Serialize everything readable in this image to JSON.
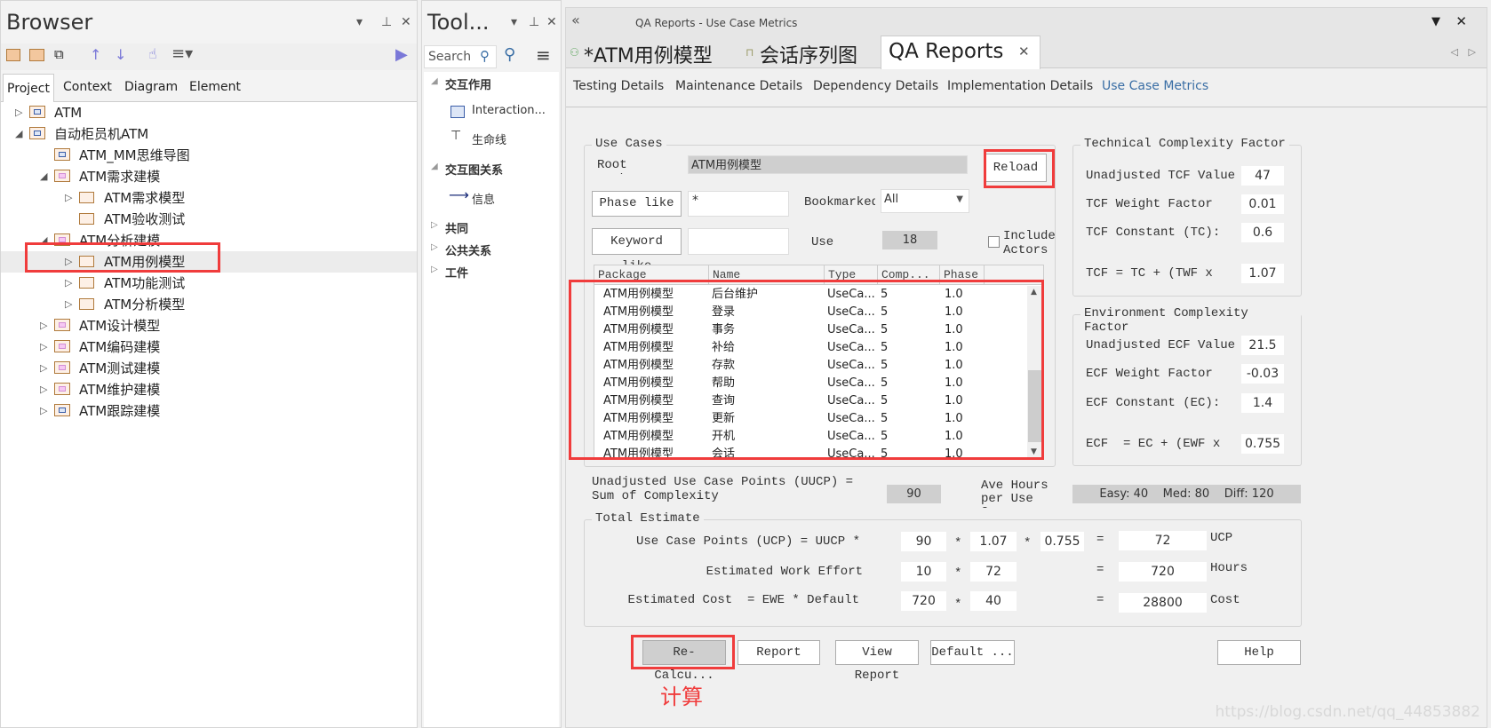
{
  "browser": {
    "title": "Browser",
    "tabs": [
      "Project",
      "Context",
      "Diagram",
      "Element"
    ],
    "tree": [
      {
        "label": "ATM",
        "level": 0,
        "expander": "collapsed",
        "icon": "package-icon"
      },
      {
        "label": "自动柜员机ATM",
        "level": 0,
        "expander": "expanded",
        "icon": "package-icon"
      },
      {
        "label": "ATM_MM思维导图",
        "level": 1,
        "expander": "none",
        "icon": "view-icon-blue"
      },
      {
        "label": "ATM需求建模",
        "level": 1,
        "expander": "expanded",
        "icon": "view-icon"
      },
      {
        "label": "ATM需求模型",
        "level": 2,
        "expander": "collapsed",
        "icon": "folder-icon"
      },
      {
        "label": "ATM验收测试",
        "level": 2,
        "expander": "none",
        "icon": "folder-icon"
      },
      {
        "label": "ATM分析建模",
        "level": 1,
        "expander": "expanded",
        "icon": "view-icon"
      },
      {
        "label": "ATM用例模型",
        "level": 2,
        "expander": "collapsed",
        "icon": "folder-icon",
        "selected": true
      },
      {
        "label": "ATM功能测试",
        "level": 2,
        "expander": "collapsed",
        "icon": "folder-icon"
      },
      {
        "label": "ATM分析模型",
        "level": 2,
        "expander": "collapsed",
        "icon": "folder-icon"
      },
      {
        "label": "ATM设计模型",
        "level": 1,
        "expander": "collapsed",
        "icon": "view-icon"
      },
      {
        "label": "ATM编码建模",
        "level": 1,
        "expander": "collapsed",
        "icon": "view-icon"
      },
      {
        "label": "ATM测试建模",
        "level": 1,
        "expander": "collapsed",
        "icon": "view-icon"
      },
      {
        "label": "ATM维护建模",
        "level": 1,
        "expander": "collapsed",
        "icon": "view-icon"
      },
      {
        "label": "ATM跟踪建模",
        "level": 1,
        "expander": "collapsed",
        "icon": "view-icon-blue"
      }
    ]
  },
  "toolbox": {
    "title": "Tool...",
    "search_placeholder": "Search",
    "sections": [
      {
        "label": "交互作用",
        "expanded": true,
        "items": [
          "Interaction...",
          "生命线"
        ]
      },
      {
        "label": "交互图关系",
        "expanded": true,
        "items": [
          "信息"
        ]
      },
      {
        "label": "共同",
        "expanded": false,
        "items": []
      },
      {
        "label": "公共关系",
        "expanded": false,
        "items": []
      },
      {
        "label": "工件",
        "expanded": false,
        "items": []
      }
    ]
  },
  "main": {
    "window_title": "QA Reports - Use Case Metrics",
    "doc_tabs": [
      {
        "label": "*ATM用例模型"
      },
      {
        "label": "会话序列图"
      },
      {
        "label": "QA Reports",
        "active": true
      }
    ],
    "sub_tabs": [
      "Testing Details",
      "Maintenance Details",
      "Dependency Details",
      "Implementation Details",
      "Use Case Metrics"
    ],
    "active_sub_tab": "Use Case Metrics"
  },
  "use_cases": {
    "group_label": "Use Cases",
    "root_label": "Root Package",
    "root_value": "ATM用例模型",
    "reload": "Reload",
    "phase_button": "Phase like",
    "phase_value": "*",
    "bookmarked_label": "Bookmarked",
    "bookmarked_value": "All",
    "keyword_button": "Keyword like",
    "keyword_value": "",
    "use_label": "Use",
    "use_count": "18",
    "include_actors": "Include Actors",
    "include_actors_checked": false,
    "columns": [
      "Package",
      "Name",
      "Type",
      "Comp...",
      "Phase"
    ],
    "rows": [
      [
        "ATM用例模型",
        "后台维护",
        "UseCa...",
        "5",
        "1.0"
      ],
      [
        "ATM用例模型",
        "登录",
        "UseCa...",
        "5",
        "1.0"
      ],
      [
        "ATM用例模型",
        "事务",
        "UseCa...",
        "5",
        "1.0"
      ],
      [
        "ATM用例模型",
        "补给",
        "UseCa...",
        "5",
        "1.0"
      ],
      [
        "ATM用例模型",
        "存款",
        "UseCa...",
        "5",
        "1.0"
      ],
      [
        "ATM用例模型",
        "帮助",
        "UseCa...",
        "5",
        "1.0"
      ],
      [
        "ATM用例模型",
        "查询",
        "UseCa...",
        "5",
        "1.0"
      ],
      [
        "ATM用例模型",
        "更新",
        "UseCa...",
        "5",
        "1.0"
      ],
      [
        "ATM用例模型",
        "开机",
        "UseCa...",
        "5",
        "1.0"
      ],
      [
        "ATM用例模型",
        "会话",
        "UseCa...",
        "5",
        "1.0"
      ]
    ]
  },
  "tcf": {
    "group_label": "Technical Complexity Factor",
    "rows": [
      {
        "label": "Unadjusted TCF Value",
        "value": "47"
      },
      {
        "label": "TCF Weight Factor",
        "value": "0.01"
      },
      {
        "label": "TCF Constant (TC):",
        "value": "0.6"
      },
      {
        "label": "TCF = TC + (TWF x",
        "value": "1.07"
      }
    ]
  },
  "ecf": {
    "group_label": "Environment Complexity Factor",
    "rows": [
      {
        "label": "Unadjusted ECF Value",
        "value": "21.5"
      },
      {
        "label": "ECF Weight Factor",
        "value": "-0.03"
      },
      {
        "label": "ECF Constant (EC):",
        "value": "1.4"
      },
      {
        "label": "ECF  = EC + (EWF x",
        "value": "0.755"
      }
    ]
  },
  "uucp": {
    "label": "Unadjusted Use Case Points (UUCP) = Sum of Complexity",
    "value": "90",
    "ave_label": "Ave Hours per Use Case",
    "ave_value": "Easy: 40    Med: 80    Diff: 120"
  },
  "total": {
    "group_label": "Total Estimate",
    "ucp": {
      "label": "Use Case Points (UCP) = UUCP *",
      "a": "90",
      "b": "1.07",
      "c": "0.755",
      "result": "72",
      "unit": "UCP"
    },
    "effort": {
      "label": "Estimated Work Effort",
      "a": "10",
      "b": "72",
      "result": "720",
      "unit": "Hours"
    },
    "cost": {
      "label": "Estimated Cost  = EWE * Default",
      "a": "720",
      "b": "40",
      "result": "28800",
      "unit": "Cost"
    }
  },
  "buttons": {
    "recalc": "Re-Calcu...",
    "report": "Report",
    "view_report": "View Report",
    "default": "Default ...",
    "help": "Help"
  },
  "annotation": "计算",
  "watermark": "https://blog.csdn.net/qq_44853882",
  "colors": {
    "highlight_red": "#f03c3c",
    "active_tab_text": "#3a6ea5"
  }
}
